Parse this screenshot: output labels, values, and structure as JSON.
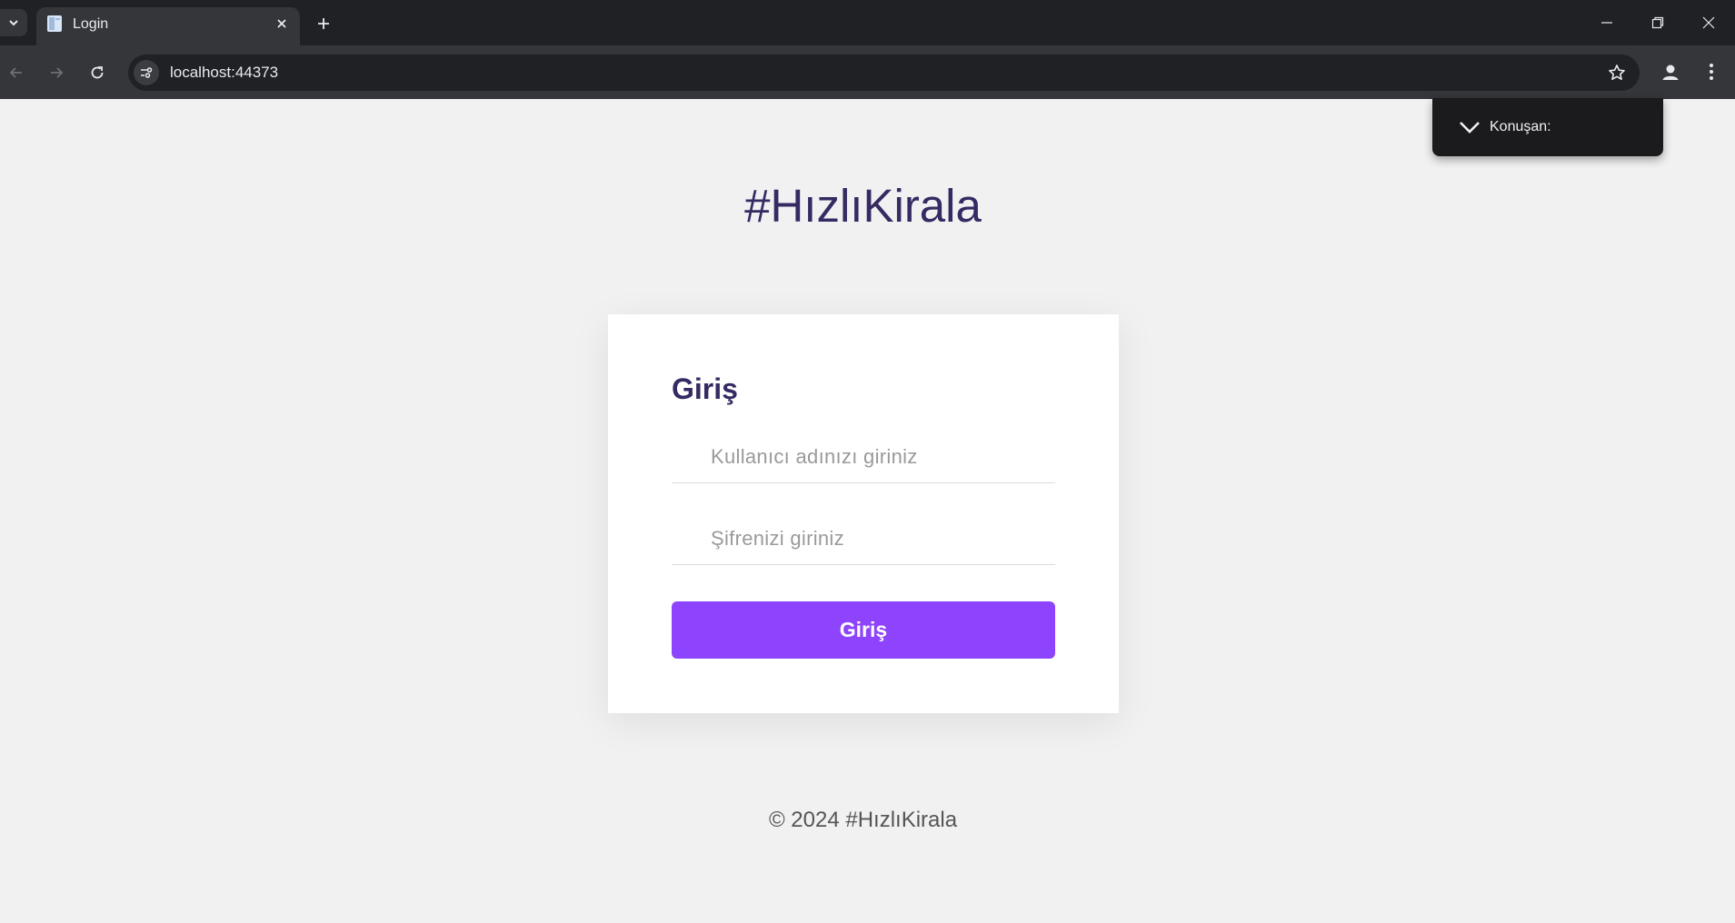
{
  "browser": {
    "tab_title": "Login",
    "url": "localhost:44373"
  },
  "page": {
    "brand": "#HızlıKirala",
    "login_card": {
      "title": "Giriş",
      "username_placeholder": "Kullanıcı adınızı giriniz",
      "password_placeholder": "Şifrenizi giriniz",
      "submit_label": "Giriş"
    },
    "footer": "© 2024 #HızlıKirala"
  },
  "speaker_panel": {
    "label": "Konuşan:"
  },
  "colors": {
    "brand_text": "#362a63",
    "primary_button": "#8e44fc",
    "page_background": "#f1f1f1",
    "browser_dark": "#202124"
  },
  "icons": [
    "tab-list-icon",
    "page-favicon-icon",
    "close-icon",
    "plus-icon",
    "minimize-icon",
    "restore-icon",
    "window-close-icon",
    "back-arrow-icon",
    "forward-arrow-icon",
    "reload-icon",
    "site-settings-icon",
    "star-icon",
    "profile-icon",
    "more-vert-icon",
    "chevron-down-icon"
  ]
}
